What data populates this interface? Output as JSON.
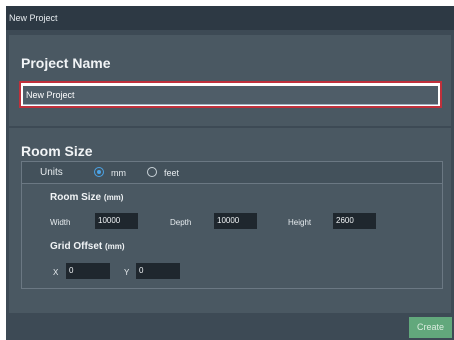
{
  "window": {
    "title": "New Project"
  },
  "project": {
    "section_title": "Project Name",
    "name_value": "New Project"
  },
  "room": {
    "section_title": "Room Size",
    "units": {
      "label": "Units",
      "options": [
        {
          "label": "mm",
          "selected": true
        },
        {
          "label": "feet",
          "selected": false
        }
      ]
    },
    "room_size": {
      "title": "Room Size",
      "unit": "(mm)",
      "width_label": "Width",
      "width_value": "10000",
      "depth_label": "Depth",
      "depth_value": "10000",
      "height_label": "Height",
      "height_value": "2600"
    },
    "grid_offset": {
      "title": "Grid Offset",
      "unit": "(mm)",
      "x_label": "X",
      "x_value": "0",
      "y_label": "Y",
      "y_value": "0"
    }
  },
  "footer": {
    "create_label": "Create"
  },
  "colors": {
    "window_bg": "#3d4a55",
    "panel_bg": "#4a5862",
    "focus_outline": "#c0303b",
    "radio_accent": "#4ba3e6",
    "create_button": "#62a87c"
  }
}
